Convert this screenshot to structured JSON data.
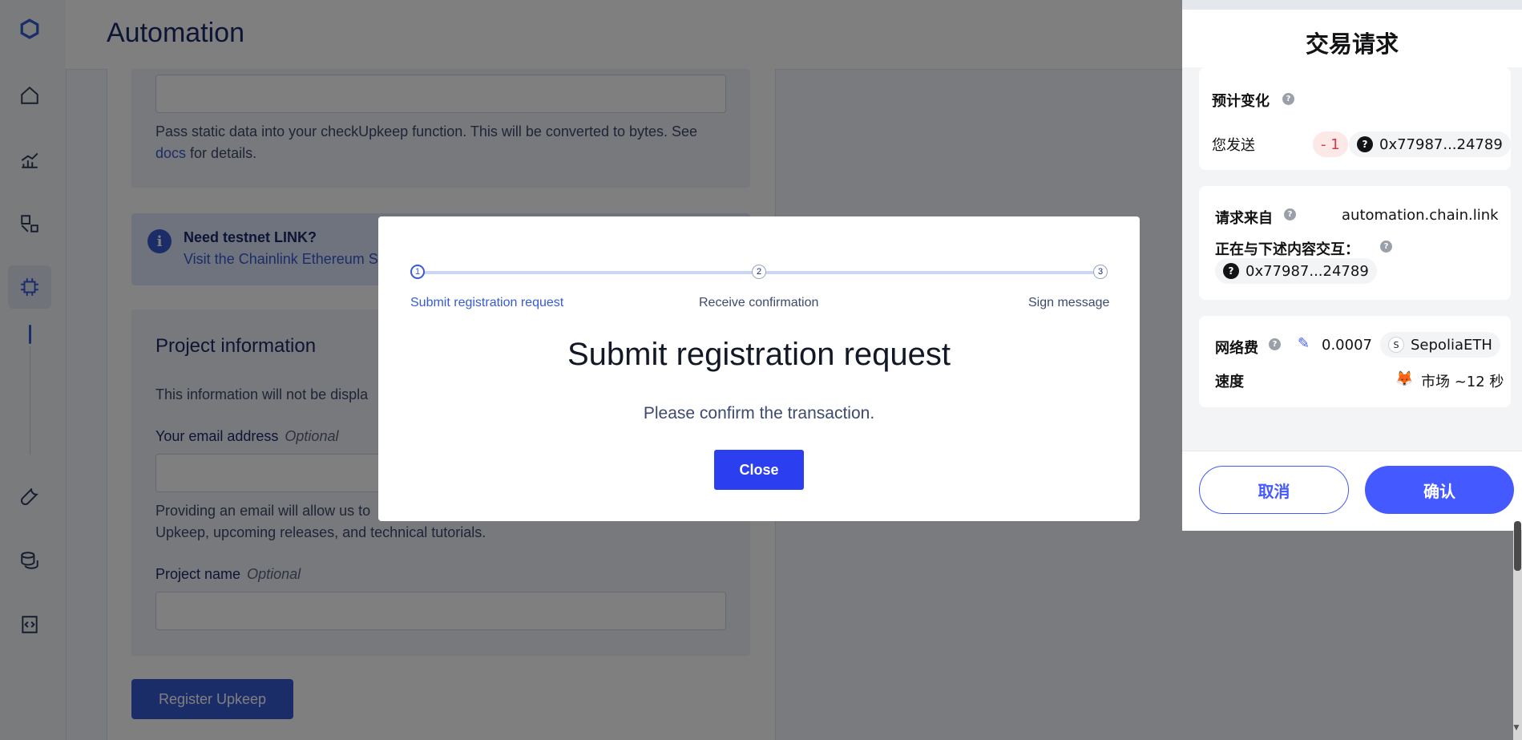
{
  "app": {
    "title": "Automation"
  },
  "sidebar": {
    "items": [
      {
        "icon": "home-icon"
      },
      {
        "icon": "chart-icon"
      },
      {
        "icon": "shapes-icon"
      },
      {
        "icon": "chip-icon",
        "active": true
      },
      {
        "icon": "wrench-icon"
      },
      {
        "icon": "coins-icon"
      },
      {
        "icon": "code-icon"
      }
    ]
  },
  "form": {
    "checkdata_help": "Pass static data into your checkUpkeep function. This will be converted to bytes. See",
    "docs_link": "docs",
    "checkdata_help_tail": "for details.",
    "info_title": "Need testnet LINK?",
    "info_link": "Visit the Chainlink Ethereum S",
    "project_section": "Project information",
    "project_desc": "This information will not be displa",
    "email_label": "Your email address",
    "email_optional": "Optional",
    "email_help_1": "Providing an email will allow us to",
    "email_help_2": "Upkeep, upcoming releases, and technical tutorials.",
    "project_name_label": "Project name",
    "project_name_optional": "Optional",
    "register_button": "Register Upkeep"
  },
  "modal": {
    "steps": [
      {
        "num": "1",
        "label": "Submit registration request",
        "active": true
      },
      {
        "num": "2",
        "label": "Receive confirmation"
      },
      {
        "num": "3",
        "label": "Sign message"
      }
    ],
    "title": "Submit registration request",
    "message": "Please confirm the transaction.",
    "close_button": "Close"
  },
  "wallet": {
    "title": "交易请求",
    "estimated_changes": "预计变化",
    "you_send": "您发送",
    "send_amount": "- 1",
    "send_address": "0x77987...24789",
    "request_from_label": "请求来自",
    "request_from_value": "automation.chain.link",
    "interacting_label": "正在与下述内容交互：",
    "interacting_address": "0x77987...24789",
    "network_fee_label": "网络费",
    "network_fee_value": "0.0007",
    "network_fee_token": "SepoliaETH",
    "token_badge": "S",
    "speed_label": "速度",
    "speed_value": "市场 ~12 秒",
    "cancel_button": "取消",
    "confirm_button": "确认"
  }
}
